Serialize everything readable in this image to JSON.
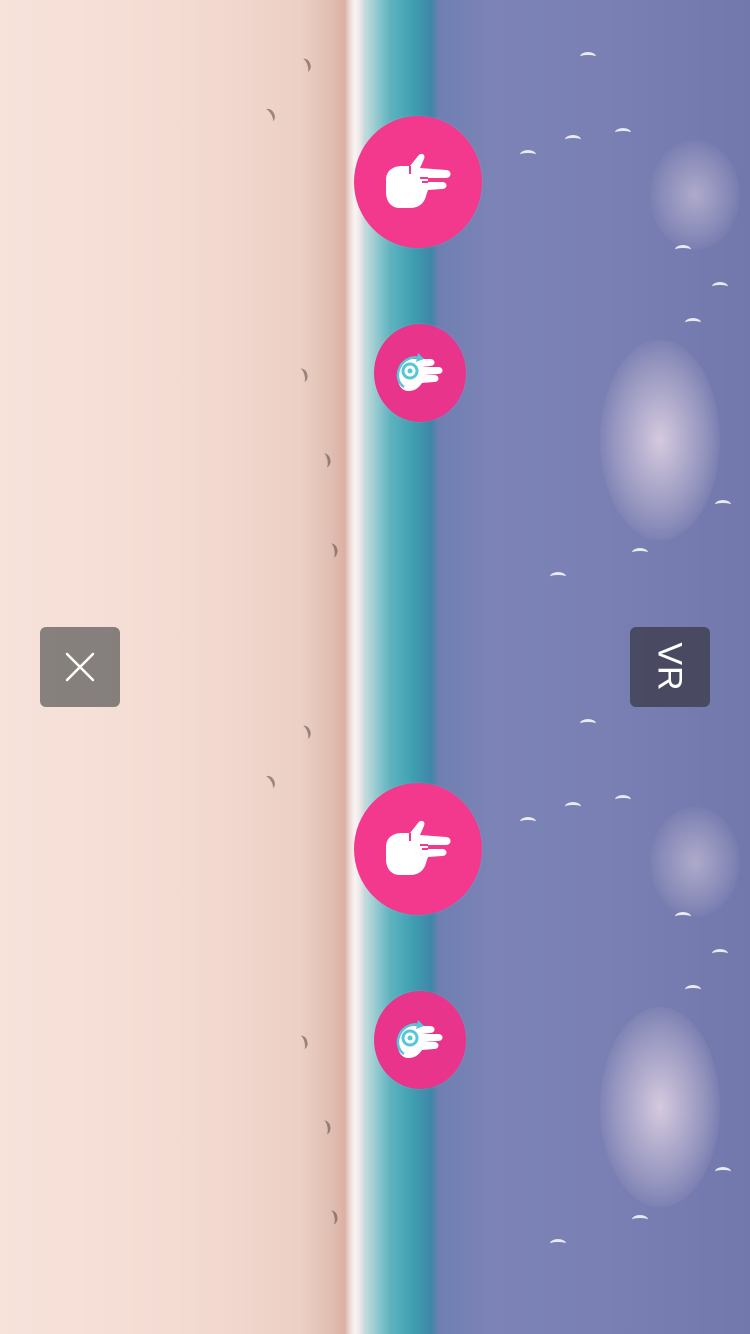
{
  "screen": {
    "mode": "vr-split-view",
    "background_description_colors": {
      "sand": "#f4dbd2",
      "water": "#3f9fb2",
      "sky": "#7a80b3"
    }
  },
  "eye_views": [
    {
      "id": "top",
      "gesture_buttons": [
        {
          "icon": "hand-pointing-icon",
          "color": "#f2398e"
        },
        {
          "icon": "hand-rotate-icon",
          "color": "#e8348a"
        }
      ]
    },
    {
      "id": "bottom",
      "gesture_buttons": [
        {
          "icon": "hand-pointing-icon",
          "color": "#f2398e"
        },
        {
          "icon": "hand-rotate-icon",
          "color": "#e8348a"
        }
      ]
    }
  ],
  "controls": {
    "close": {
      "icon": "close-icon"
    },
    "vr": {
      "label": "VR"
    }
  }
}
